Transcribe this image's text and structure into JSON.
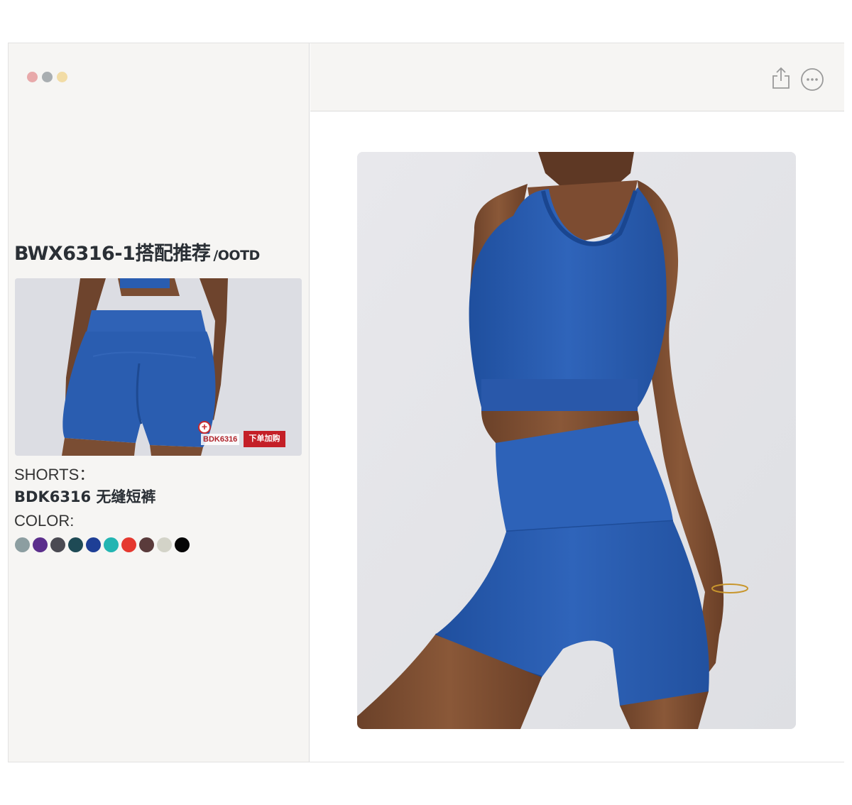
{
  "colors": {
    "window_bg": "#f6f5f3",
    "accent_red": "#c41f27",
    "garment_blue": "#2a5db0"
  },
  "window": {
    "traffic_lights": [
      "#e8a9aa",
      "#a9aeb1",
      "#f2dca5"
    ]
  },
  "toolbar": {
    "share_icon": "share-icon",
    "more_icon": "more-options-icon"
  },
  "product": {
    "title": "BWX6316-1搭配推荐",
    "title_suffix": "/OOTD",
    "thumb_sku_tag": "BDK6316",
    "thumb_buy_label": "下单加购",
    "shorts_label": "SHORTS：",
    "shorts_name": "BDK6316 无缝短裤",
    "color_label": "COLOR:",
    "swatches": [
      "#8c9ea1",
      "#5b2e8c",
      "#4a4a52",
      "#1e4a55",
      "#1e3f96",
      "#23b5b2",
      "#e5382f",
      "#5a3b3b",
      "#d3d3c8",
      "#050505"
    ]
  }
}
